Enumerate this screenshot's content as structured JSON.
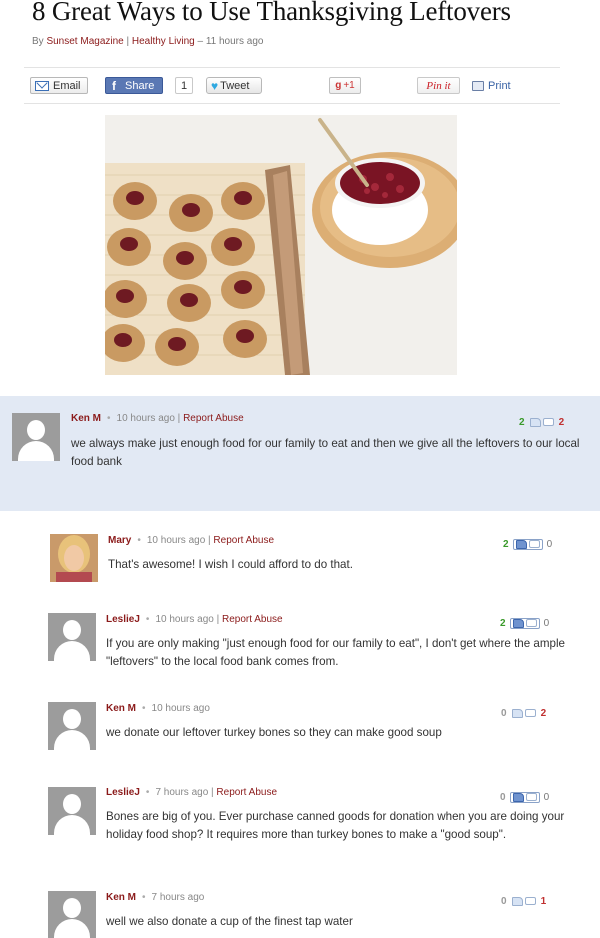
{
  "article": {
    "title": "8 Great Ways to Use Thanksgiving Leftovers",
    "by": "By ",
    "source": "Sunset Magazine",
    "sep": " | ",
    "section": "Healthy Living",
    "time": " – 11 hours ago"
  },
  "share": {
    "email": "Email",
    "share": "Share",
    "share_count": "1",
    "tweet": "Tweet",
    "gplus": "+1",
    "pin": "Pin it",
    "print": "Print"
  },
  "comments": [
    {
      "author": "Ken M",
      "time": "10 hours ago",
      "report": "Report Abuse",
      "text": "we always make just enough food for our family to eat and then we give all the leftovers to our local food bank",
      "up": "2",
      "down": "2"
    },
    {
      "author": "Mary",
      "time": "10 hours ago",
      "report": "Report Abuse",
      "text": "That's awesome! I wish I could afford to do that.",
      "up": "2",
      "down": "0"
    },
    {
      "author": "LeslieJ",
      "time": "10 hours ago",
      "report": "Report Abuse",
      "text": "If you are only making \"just enough food for our family to eat\", I don't get where the ample \"leftovers\" to the local food bank comes from.",
      "up": "2",
      "down": "0"
    },
    {
      "author": "Ken M",
      "time": "10 hours ago",
      "report": "",
      "text": "we donate our leftover turkey bones so they can make good soup",
      "up": "0",
      "down": "2"
    },
    {
      "author": "LeslieJ",
      "time": "7 hours ago",
      "report": "Report Abuse",
      "text": "Bones are big of you. Ever purchase canned goods for donation when you are doing your holiday food shop? It requires more than turkey bones to make a \"good soup\".",
      "up": "0",
      "down": "0"
    },
    {
      "author": "Ken M",
      "time": "7 hours ago",
      "report": "",
      "text": "well we also donate a cup of the finest tap water",
      "up": "0",
      "down": "1"
    }
  ],
  "colors": {
    "accent": "#8b1a1a",
    "highlight_bg": "#e2e9f4",
    "vote_up": "#3a9a2a",
    "vote_down": "#c03030"
  }
}
